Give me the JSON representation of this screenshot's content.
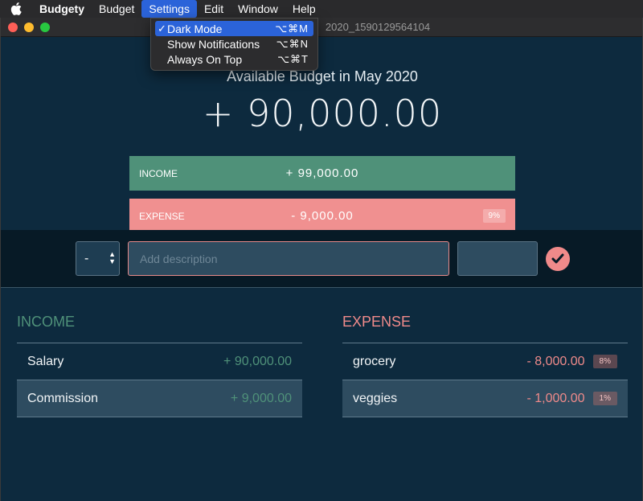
{
  "menubar": {
    "app_name": "Budgety",
    "items": [
      "Budget",
      "Settings",
      "Edit",
      "Window",
      "Help"
    ]
  },
  "settings_menu": [
    {
      "label": "Dark Mode",
      "shortcut": "⌥⌘M",
      "checked": "✓"
    },
    {
      "label": "Show Notifications",
      "shortcut": "⌥⌘N"
    },
    {
      "label": "Always On Top",
      "shortcut": "⌥⌘T"
    }
  ],
  "window": {
    "title": "2020_1590129564104"
  },
  "header": {
    "month_label": "Available Budget in May 2020",
    "total": "+ 90,000.00",
    "income_label": "Income",
    "income_value": "+ 99,000.00",
    "expense_label": "Expense",
    "expense_value": "- 9,000.00",
    "expense_percent": "9%"
  },
  "add": {
    "type_value": "-",
    "description_placeholder": "Add description",
    "value_placeholder": ""
  },
  "income": {
    "title": "Income",
    "items": [
      {
        "description": "Salary",
        "value": "+ 90,000.00"
      },
      {
        "description": "Commission",
        "value": "+ 9,000.00"
      }
    ]
  },
  "expense": {
    "title": "Expense",
    "items": [
      {
        "description": "grocery",
        "value": "- 8,000.00",
        "percent": "8%"
      },
      {
        "description": "veggies",
        "value": "- 1,000.00",
        "percent": "1%"
      }
    ]
  },
  "colors": {
    "background": "#0d2a3e",
    "income": "#4f9179",
    "expense": "#f09090",
    "menu_highlight": "#2b63d9"
  }
}
